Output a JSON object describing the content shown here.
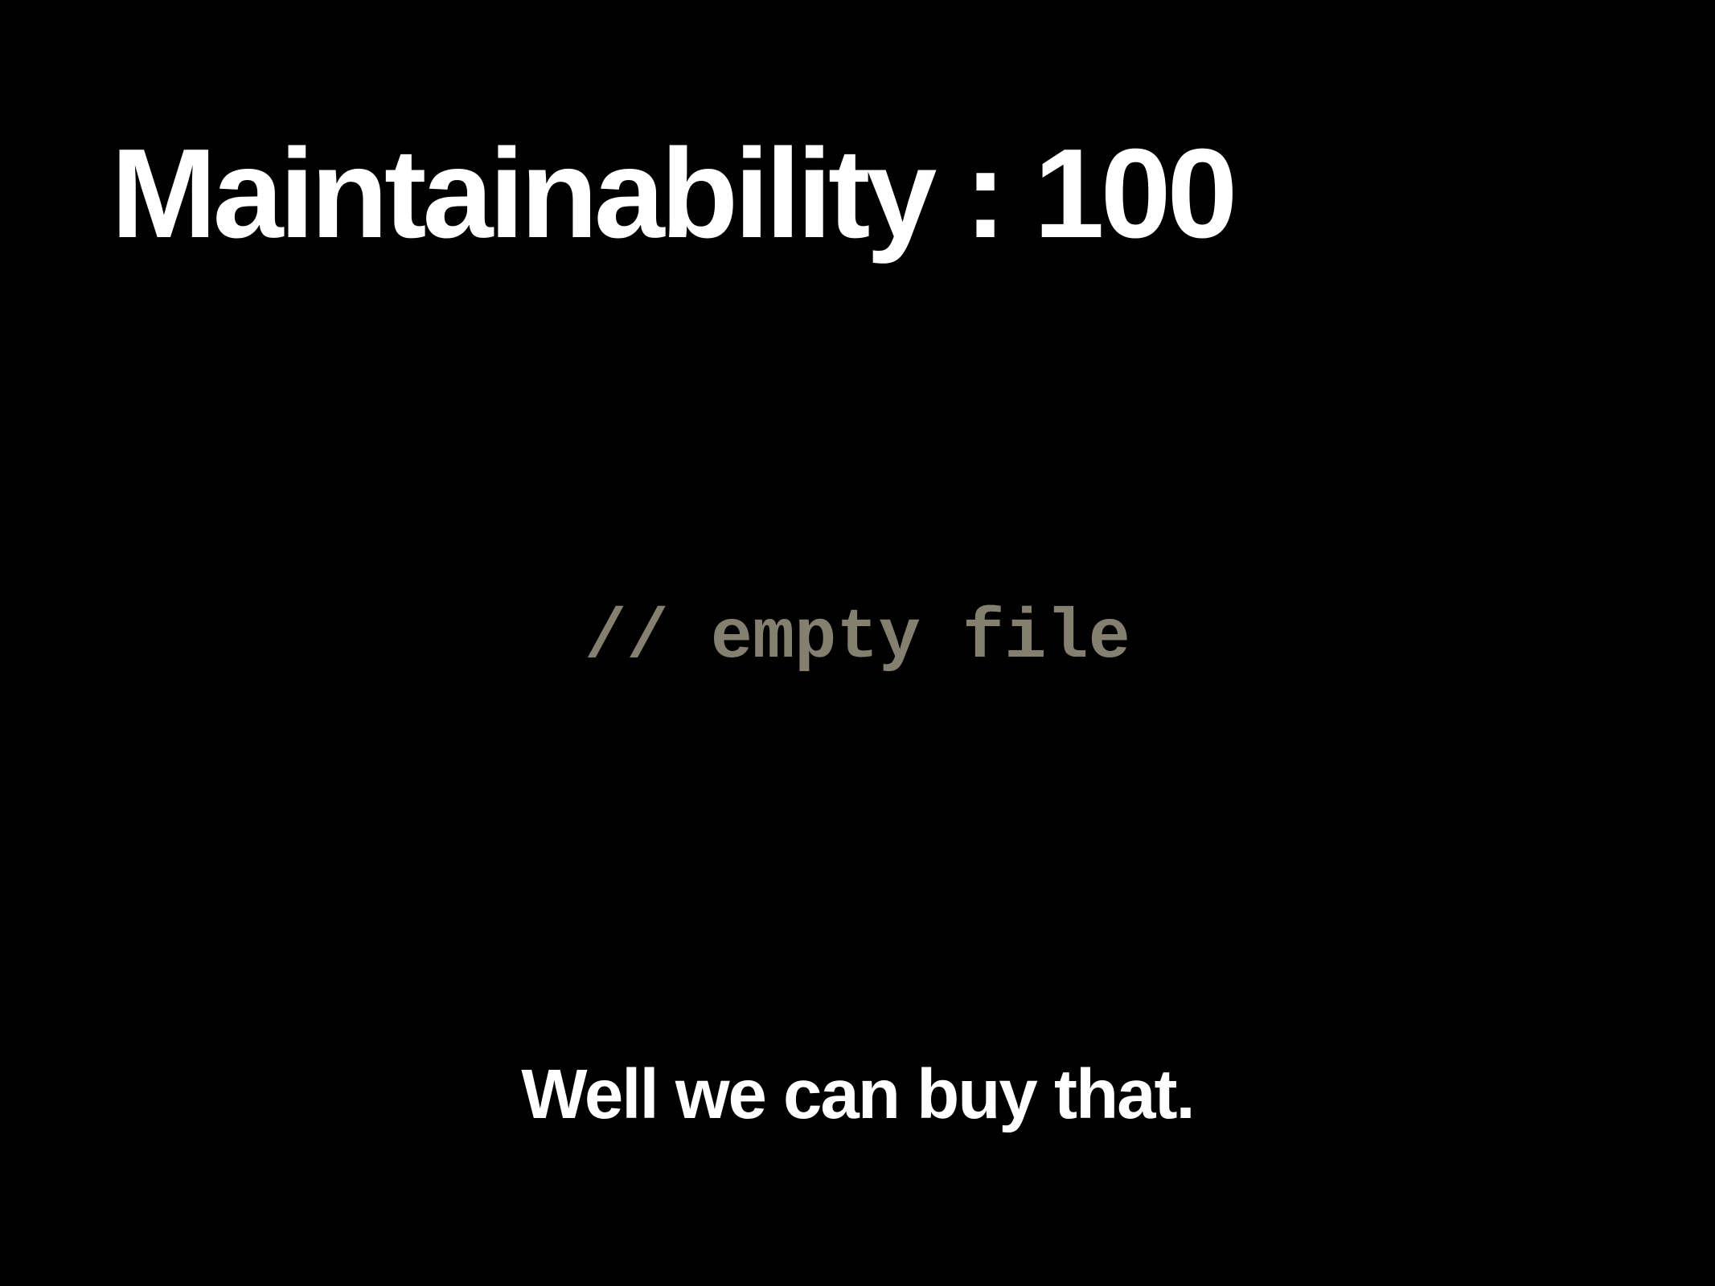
{
  "slide": {
    "title": "Maintainability : 100",
    "code_line": "// empty file",
    "caption": "Well we can buy that."
  },
  "colors": {
    "background": "#000000",
    "title_text": "#ffffff",
    "code_text": "#857f70",
    "caption_text": "#ffffff"
  }
}
